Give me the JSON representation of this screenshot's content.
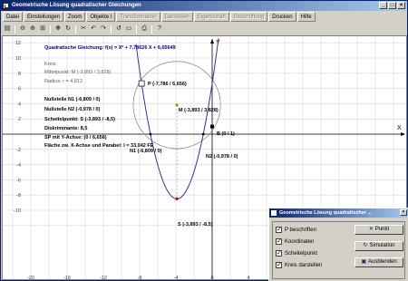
{
  "window": {
    "title": "Geometrische Lösung quadratischer Gleichungen",
    "min": "_",
    "max": "□",
    "close": "×"
  },
  "menu": [
    {
      "label": "Datei",
      "disabled": false
    },
    {
      "label": "Einstellungen",
      "disabled": false
    },
    {
      "label": "Zoom",
      "disabled": false
    },
    {
      "label": "Objekte I",
      "disabled": false
    },
    {
      "label": "Transformation",
      "disabled": true
    },
    {
      "label": "Darstellen",
      "disabled": true
    },
    {
      "label": "Eigenschaft",
      "disabled": true
    },
    {
      "label": "Beschriftung",
      "disabled": true
    },
    {
      "label": "Drucken",
      "disabled": false
    },
    {
      "label": "Hilfe",
      "disabled": false
    }
  ],
  "toolbar_icons": [
    "file-icon",
    "sep",
    "zoom-out-icon",
    "zoom-in-icon",
    "zoom-window-icon",
    "sep",
    "move-icon",
    "rotate-icon",
    "sep",
    "cut-icon",
    "undo-icon",
    "redo-icon",
    "sep",
    "refresh-icon",
    "select-icon",
    "sep",
    "print-icon",
    "sep",
    "help-icon"
  ],
  "toolbar_glyphs": [
    "▤",
    "",
    "⊖",
    "⊕",
    "⊞",
    "",
    "✥",
    "↻",
    "",
    "✂",
    "↶",
    "↷",
    "",
    "↺",
    "▭",
    "",
    "⎙",
    "",
    "?"
  ],
  "info": {
    "function": "Quadratische Gleichung: f(x) = X² + 7,78626 X + 6,65649",
    "circle_heading": "Kreis:",
    "center": "Mittelpunkt: M (-3,893 / 3,828)",
    "radius": "Radius: r = 4,812",
    "zero1": "Nullstelle N1 (-6,809 / 0)",
    "zero2": "Nullstelle N2 (-0,978 / 0)",
    "vertex": "Scheitelpunkt: S (-3,893 / -8,5)",
    "discriminant": "Diskriminante: 8,5",
    "sp_y": "SP mit Y-Achse: (0 / 6,656)",
    "area": "Fläche zw. X-Achse und Parabel: I = 33,042 FE"
  },
  "points": {
    "P": "P (-7,786 / 6,656)",
    "M": "M (-3,893 / 3,828)",
    "B": "B (0 / 1)",
    "N1": "N1 (-6,809 / 0)",
    "N2": "N2 (-0,978 / 0)",
    "S": "S (-3,893 / -8,5)"
  },
  "axis": {
    "x_label": "X",
    "y_label": "Y"
  },
  "x_ticks": [
    "-20",
    "-16",
    "-12",
    "-8",
    "-4",
    "0",
    "4",
    "8",
    "12",
    "16",
    "20"
  ],
  "y_ticks": [
    "12",
    "10",
    "8",
    "6",
    "4",
    "2",
    "-2",
    "-4",
    "-6",
    "-8",
    "-10"
  ],
  "colors": {
    "parabola": "#4b2a8a",
    "circle": "#808080",
    "grid": "#d8d8d8",
    "func_text": "#000080",
    "vertex": "#cc0000"
  },
  "dialog": {
    "title": "Geometrische Lösung quadratischer ...",
    "checkboxes": [
      {
        "label": "P beschriften",
        "checked": true
      },
      {
        "label": "Koordinaten",
        "checked": true
      },
      {
        "label": "Scheitelpunkt",
        "checked": true
      },
      {
        "label": "Kreis darstellen",
        "checked": true
      }
    ],
    "buttons": [
      {
        "label": "Punkt",
        "icon": "✕"
      },
      {
        "label": "Simulation",
        "icon": "↻"
      },
      {
        "label": "Ausblenden",
        "icon": "▣"
      }
    ],
    "close": "×"
  }
}
